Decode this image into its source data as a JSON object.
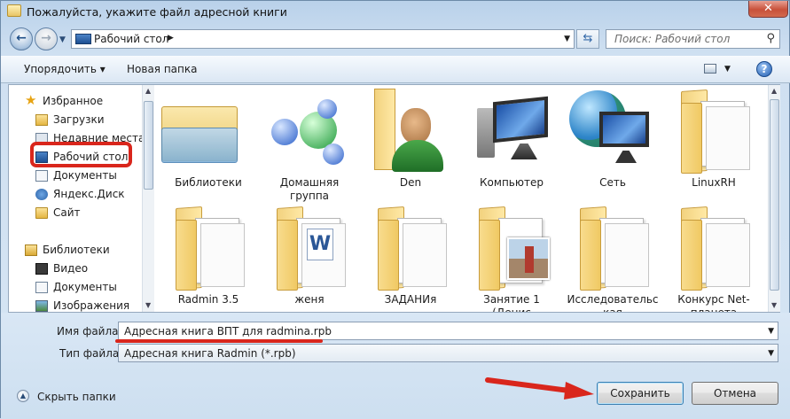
{
  "window": {
    "title": "Пожалуйста, укажите файл адресной книги",
    "close_label": "✕"
  },
  "nav": {
    "address_path": "Рабочий стол",
    "search_placeholder": "Поиск: Рабочий стол"
  },
  "toolbar": {
    "organize_label": "Упорядочить ▾",
    "new_folder_label": "Новая папка"
  },
  "sidebar": {
    "items": [
      {
        "label": "Избранное",
        "icon": "star-icon"
      },
      {
        "label": "Загрузки",
        "icon": "downloads-folder-icon"
      },
      {
        "label": "Недавние места",
        "icon": "recent-places-icon"
      },
      {
        "label": "Рабочий стол",
        "icon": "desktop-icon"
      },
      {
        "label": "Документы",
        "icon": "documents-icon"
      },
      {
        "label": "Яндекс.Диск",
        "icon": "yandex-disk-icon"
      },
      {
        "label": "Сайт",
        "icon": "folder-icon"
      },
      {
        "label": "Библиотеки",
        "icon": "libraries-icon"
      },
      {
        "label": "Видео",
        "icon": "video-icon"
      },
      {
        "label": "Документы",
        "icon": "documents-icon"
      },
      {
        "label": "Изображения",
        "icon": "images-icon"
      }
    ]
  },
  "files": [
    {
      "label": "Библиотеки",
      "icon": "libraries-icon"
    },
    {
      "label": "Домашняя группа",
      "icon": "homegroup-icon"
    },
    {
      "label": "Den",
      "icon": "user-folder-icon"
    },
    {
      "label": "Компьютер",
      "icon": "computer-icon"
    },
    {
      "label": "Сеть",
      "icon": "network-icon"
    },
    {
      "label": "LinuxRH",
      "icon": "folder-icon"
    },
    {
      "label": "Radmin 3.5",
      "icon": "folder-icon"
    },
    {
      "label": "женя",
      "icon": "word-folder-icon"
    },
    {
      "label": "ЗАДАНИя",
      "icon": "folder-icon"
    },
    {
      "label": "Занятие 1 (Денис",
      "icon": "photo-folder-icon"
    },
    {
      "label": "Исследовательс кая",
      "icon": "folder-icon"
    },
    {
      "label": "Конкурс Net-планета",
      "icon": "folder-icon"
    }
  ],
  "form": {
    "filename_label": "Имя файла:",
    "filename_value": "Адресная книга ВПТ для radmina.rpb",
    "filetype_label": "Тип файла:",
    "filetype_value": "Адресная книга Radmin (*.rpb)",
    "hide_folders_label": "Скрыть папки",
    "save_label": "Сохранить",
    "cancel_label": "Отмена"
  },
  "annotation_color": "#d9261c"
}
